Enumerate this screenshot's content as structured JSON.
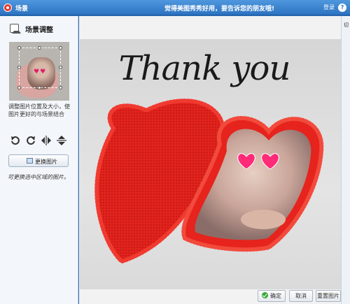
{
  "window": {
    "title": "场景",
    "promo_text": "觉得美图秀秀好用，要告诉您的朋友哦!",
    "login_label": "登录",
    "help_label": "?"
  },
  "sidebar": {
    "title": "场景调整",
    "hint": "调整图片位置及大小，使图片更好的与场景结合",
    "tools": [
      "rotate-left-icon",
      "rotate-right-icon",
      "flip-horizontal-icon",
      "flip-vertical-icon"
    ],
    "replace_button": "更换图片",
    "annotation": "可更换选中区域的图片。"
  },
  "canvas": {
    "overlay_text": "Thank you",
    "heart_color": "#e8231e"
  },
  "footer": {
    "confirm_label": "确定",
    "cancel_label": "取消",
    "replace_label": "重置图片"
  },
  "right_strip": {
    "label": "切"
  },
  "colors": {
    "titlebar": "#3b84d0",
    "accent_green": "#38a83a"
  }
}
